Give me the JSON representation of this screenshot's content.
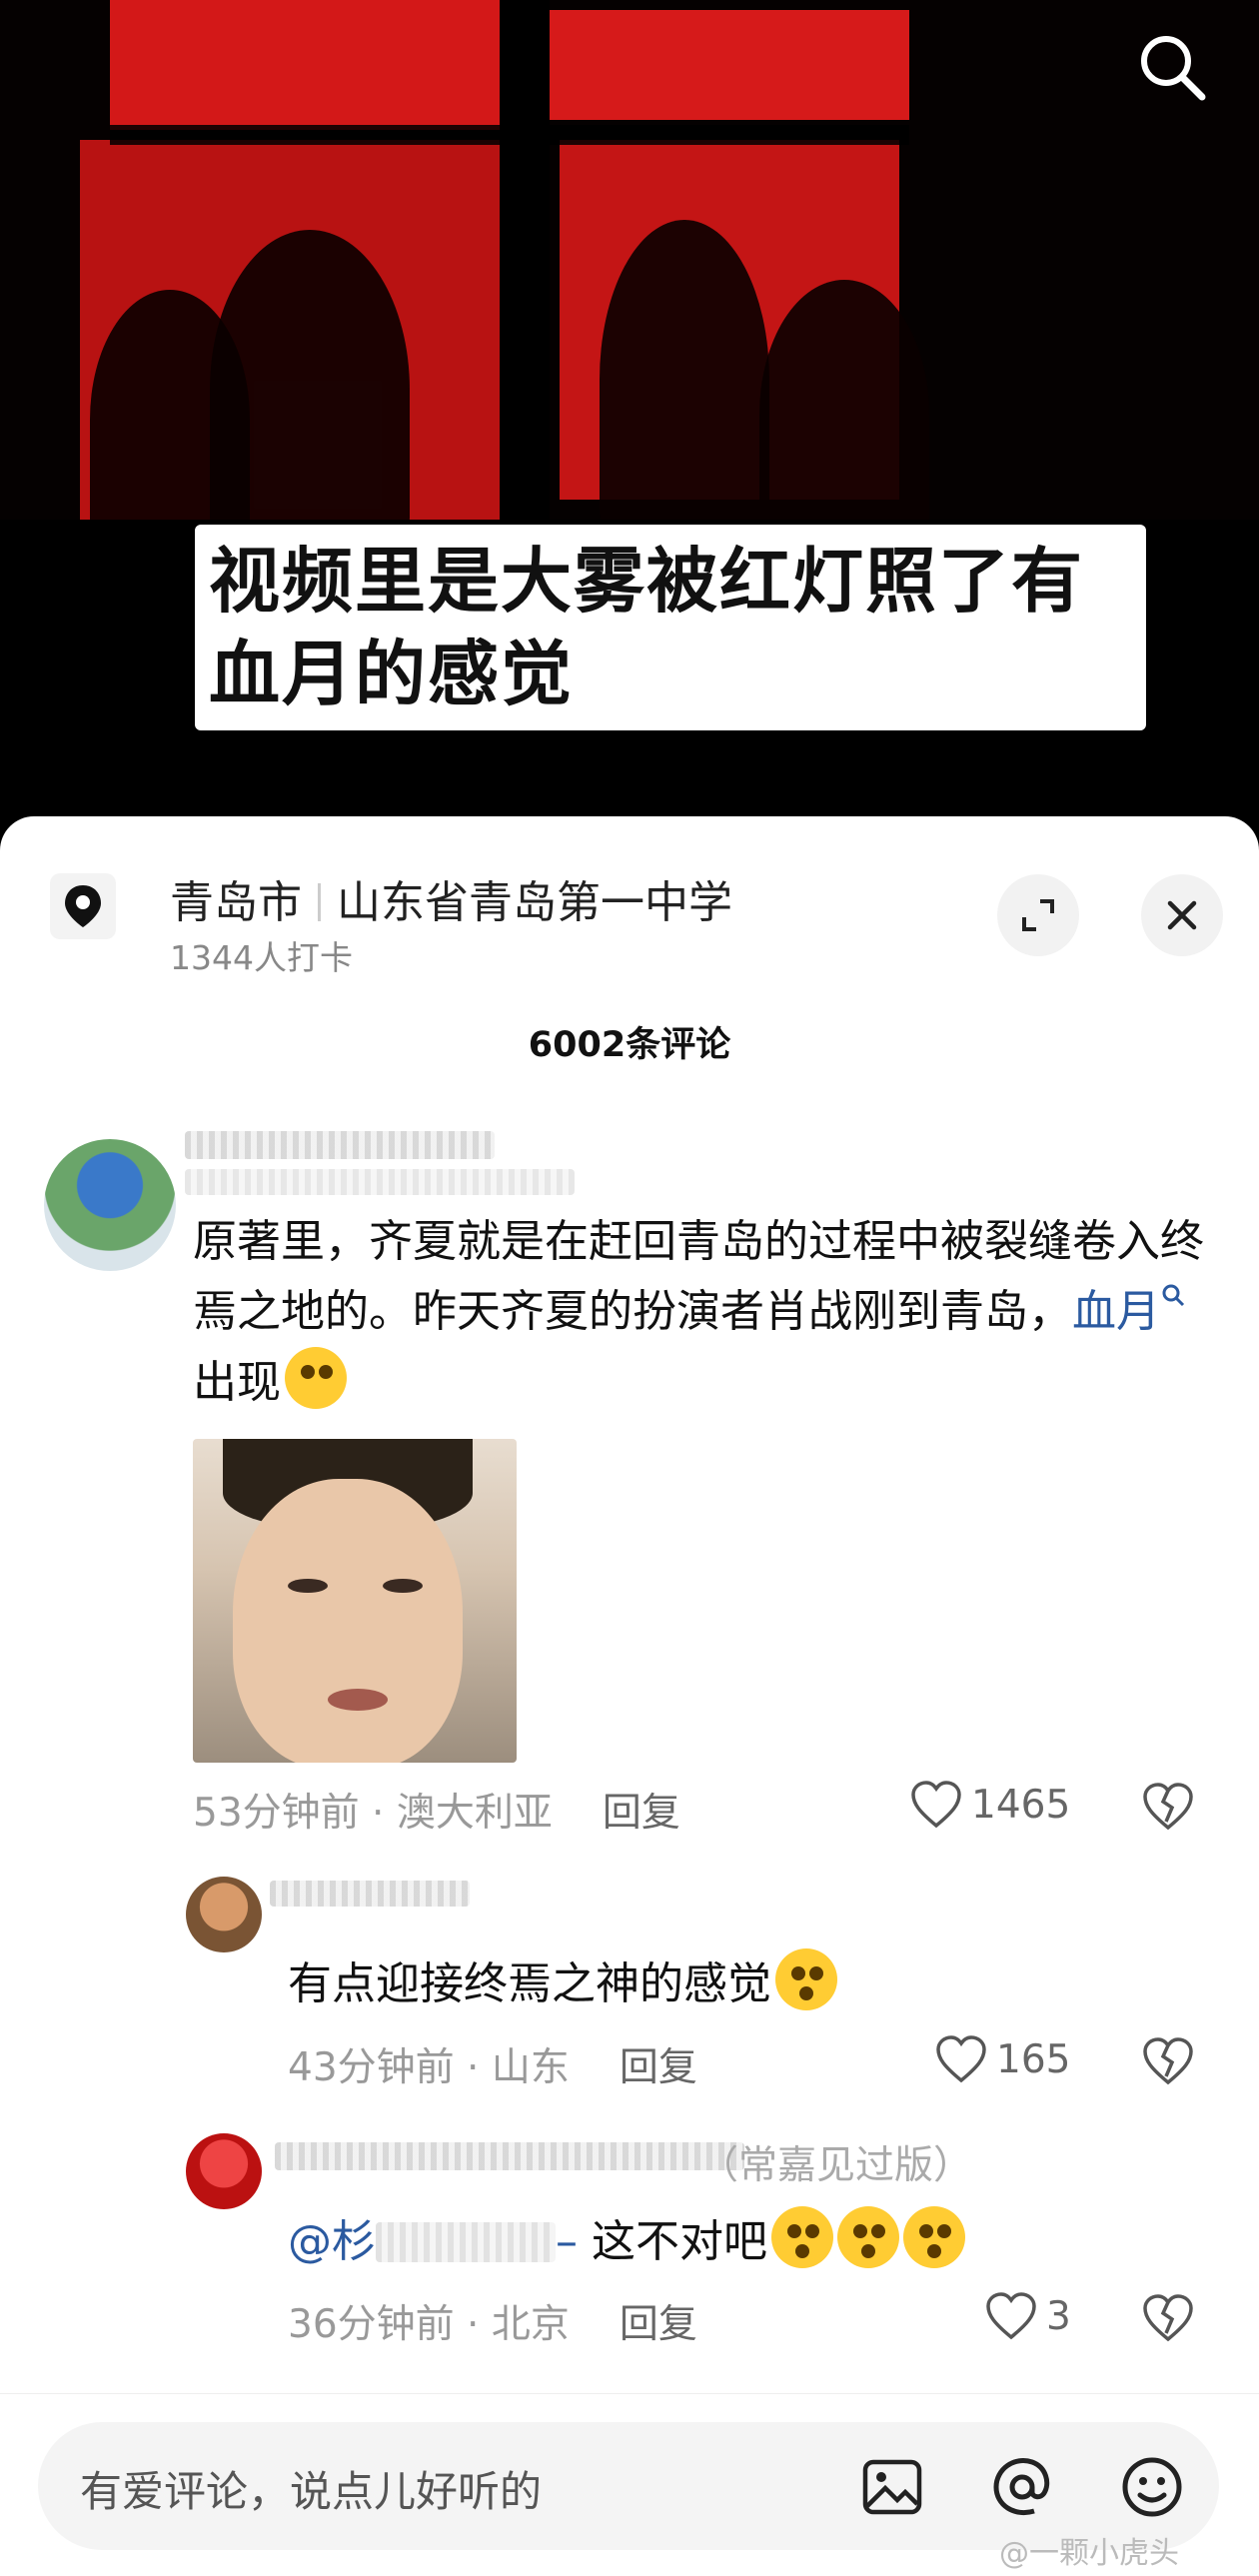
{
  "video": {
    "caption": "视频里是大雾被红灯照了有血月的感觉"
  },
  "location": {
    "city": "青岛市",
    "place": "山东省青岛第一中学",
    "checkins": "1344人打卡"
  },
  "comments_count": "6002条评论",
  "comments": [
    {
      "text_before": "原著里，齐夏就是在赶回青岛的过程中被裂缝卷入终焉之地的。昨天齐夏的扮演者肖战刚到青岛，",
      "hashtag": "血月",
      "text_after": "出现",
      "time": "53分钟前",
      "region": "澳大利亚",
      "reply_label": "回复",
      "likes": "1465"
    },
    {
      "text": "有点迎接终焉之神的感觉",
      "time": "43分钟前",
      "region": "山东",
      "reply_label": "回复",
      "likes": "165"
    },
    {
      "reply_to_name": "（常嘉见过版）",
      "mention": "@杉",
      "mention_tail": "–",
      "text": "这不对吧",
      "time": "36分钟前",
      "region": "北京",
      "reply_label": "回复",
      "likes": "3"
    }
  ],
  "input": {
    "placeholder": "有爱评论，说点儿好听的"
  },
  "watermark": "@一颗小虎头",
  "icons": [
    "search-icon",
    "location-pin-icon",
    "expand-icon",
    "close-icon",
    "heart-icon",
    "dislike-heart-icon",
    "image-icon",
    "at-icon",
    "emoji-icon"
  ]
}
